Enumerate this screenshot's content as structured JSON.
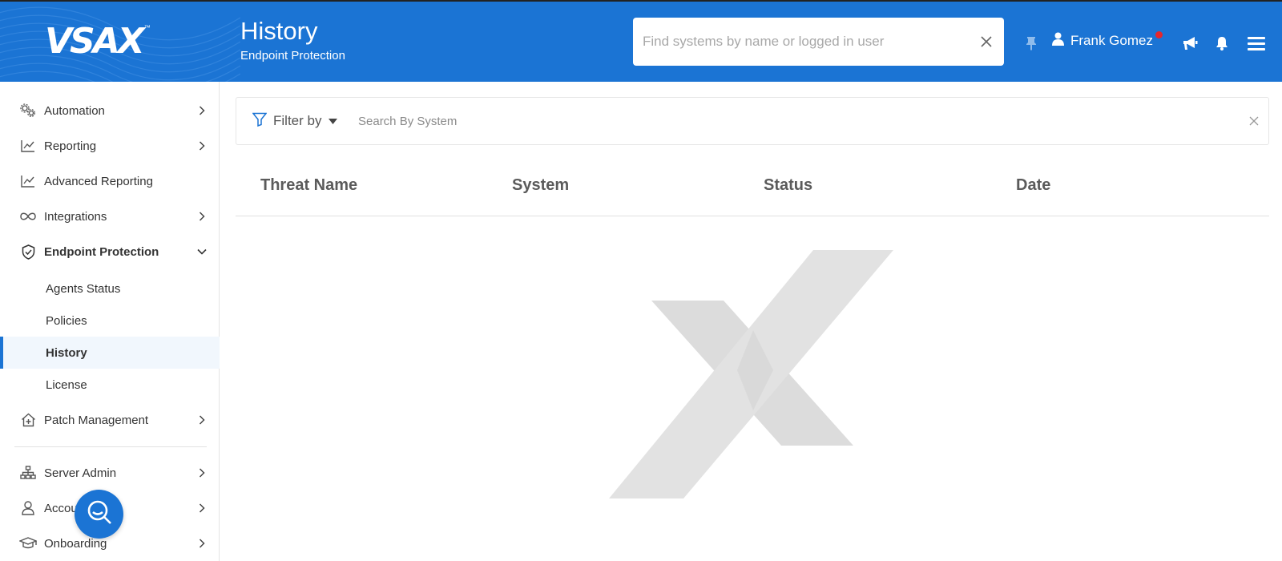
{
  "header": {
    "logo_text": "VSAX",
    "logo_tm": "™",
    "title": "History",
    "subtitle": "Endpoint Protection",
    "search_placeholder": "Find systems by name or logged in user",
    "user_name": "Frank Gomez",
    "icons": [
      "pin-icon",
      "user-icon",
      "megaphone-icon",
      "bell-icon",
      "hamburger-menu-icon"
    ],
    "brand_color": "#1b74d4",
    "notification_color": "#e5262c"
  },
  "sidebar": {
    "items": [
      {
        "label": "Automation",
        "icon": "gears-icon",
        "expandable": true
      },
      {
        "label": "Reporting",
        "icon": "line-chart-icon",
        "expandable": true
      },
      {
        "label": "Advanced Reporting",
        "icon": "line-chart-icon",
        "expandable": false
      },
      {
        "label": "Integrations",
        "icon": "infinity-icon",
        "expandable": true
      },
      {
        "label": "Endpoint Protection",
        "icon": "shield-check-icon",
        "expanded": true
      },
      {
        "label": "Patch Management",
        "icon": "home-plus-icon",
        "expandable": true
      },
      {
        "label": "Server Admin",
        "icon": "sitemap-icon",
        "expandable": true
      },
      {
        "label": "Account",
        "icon": "user-outline-icon",
        "expandable": true
      },
      {
        "label": "Onboarding",
        "icon": "graduation-cap-icon",
        "expandable": true
      }
    ],
    "sub_items": [
      {
        "label": "Agents Status"
      },
      {
        "label": "Policies"
      },
      {
        "label": "History",
        "active": true
      },
      {
        "label": "License"
      }
    ]
  },
  "filter": {
    "filter_label": "Filter by",
    "search_placeholder": "Search By System"
  },
  "table": {
    "columns": [
      "Threat Name",
      "System",
      "Status",
      "Date"
    ],
    "rows": []
  }
}
